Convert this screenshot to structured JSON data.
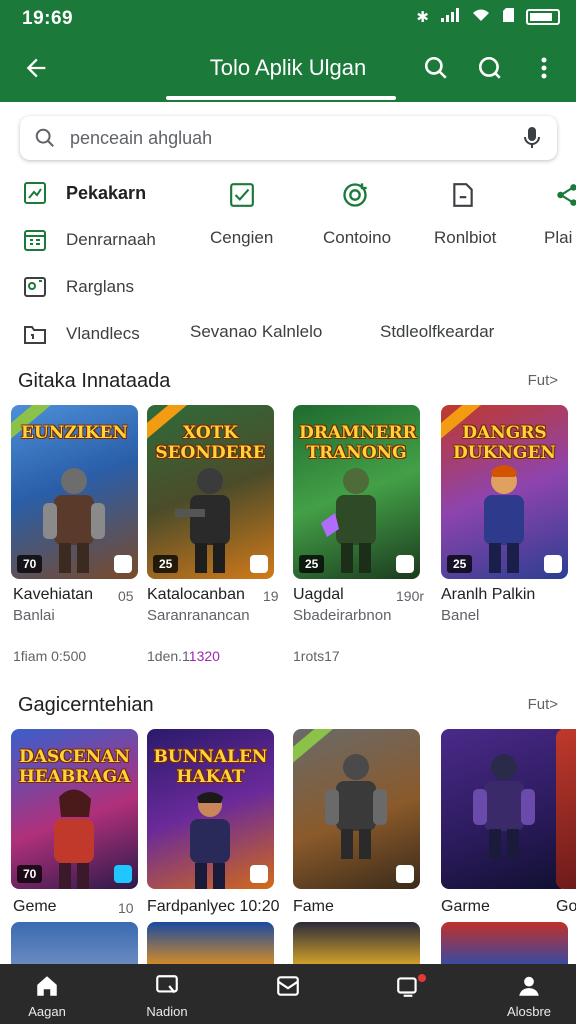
{
  "status": {
    "time": "19:69"
  },
  "app_bar": {
    "title": "Tolo Aplik Ulgan"
  },
  "search": {
    "placeholder": "penceain ahgluah"
  },
  "categories": {
    "row1": [
      "Pekakarn"
    ],
    "row2": [
      "Denrarnaah",
      "Cengien",
      "Contoino",
      "Ronlbiot",
      "Plai"
    ],
    "row3": [
      "Rarglans"
    ],
    "row4": [
      "Vlandlecs",
      "Sevanao Kalnlelo",
      "Stdleolfkeardar"
    ]
  },
  "section1": {
    "title": "Gitaka Innataada",
    "more": "Fut>",
    "cards": [
      {
        "art": "EUNZIKEN",
        "badge": "70",
        "name": "Kavehiatan",
        "num": "05",
        "sub": "Banlai",
        "price_a": "1fiam",
        "price_b": "0:500"
      },
      {
        "art": "XOTK SEONDERE",
        "badge": "25",
        "name": "Katalocanban",
        "num": "19",
        "sub": "Saranranancan",
        "price_a": "1den.1",
        "price_b": "1320"
      },
      {
        "art": "DRAMNERR TRANONG",
        "badge": "25",
        "name": "Uagdal",
        "num": "190r",
        "sub": "Sbadeirarbnon",
        "price_a": "1rots17",
        "price_b": ""
      },
      {
        "art": "DANGRS DUKNGEN",
        "badge": "25",
        "name": "Aranlh Palkin",
        "num": "",
        "sub": "Banel",
        "price_a": "",
        "price_b": ""
      }
    ]
  },
  "section2": {
    "title": "Gagicerntehian",
    "more": "Fut>",
    "cards": [
      {
        "art": "DASCENAN HEABRAGA",
        "badge": "70",
        "name": "Geme",
        "num": "10"
      },
      {
        "art": "BUNNALEN HAKAT",
        "badge": "",
        "name": "Fardpanlyec 10:20",
        "num": ""
      },
      {
        "art": "",
        "badge": "",
        "name": "Fame",
        "num": ""
      },
      {
        "art": "",
        "badge": "",
        "name": "Garme",
        "num": ""
      },
      {
        "art": "",
        "badge": "",
        "name": "Go",
        "num": ""
      }
    ]
  },
  "bottom_nav": {
    "items": [
      "Aagan",
      "Nadion",
      "",
      "",
      "Alosbre"
    ]
  },
  "colors": {
    "brand": "#1b7a3a",
    "nav": "#2a2a2a",
    "price_accent": "#9c27b0"
  }
}
